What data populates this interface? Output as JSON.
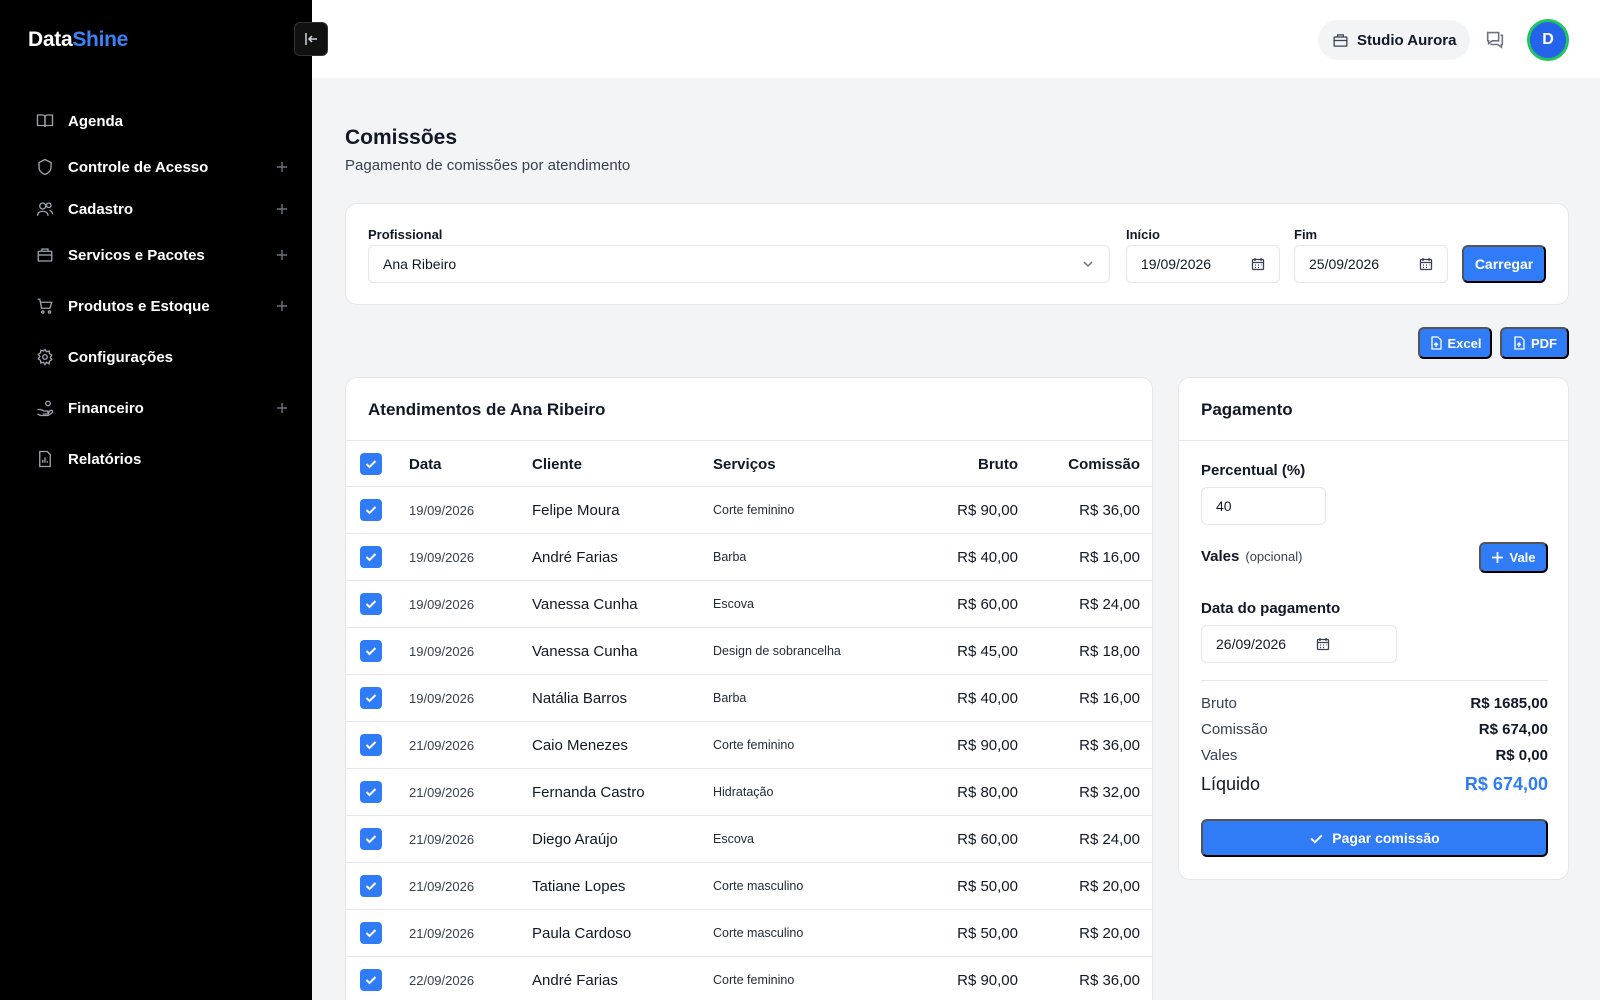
{
  "brand": {
    "part1": "Data",
    "part2": "Shine",
    "accent": "#3b82f6"
  },
  "sidebar": {
    "items": [
      {
        "label": "Agenda",
        "icon": "book-icon",
        "expandable": false
      },
      {
        "label": "Controle de Acesso",
        "icon": "shield-icon",
        "expandable": true
      },
      {
        "label": "Cadastro",
        "icon": "users-icon",
        "expandable": true
      },
      {
        "label": "Servicos e Pacotes",
        "icon": "briefcase-icon",
        "expandable": true
      },
      {
        "label": "Produtos e Estoque",
        "icon": "cart-icon",
        "expandable": true
      },
      {
        "label": "Configurações",
        "icon": "gear-icon",
        "expandable": false
      },
      {
        "label": "Financeiro",
        "icon": "hand-coins-icon",
        "expandable": true
      },
      {
        "label": "Relatórios",
        "icon": "report-icon",
        "expandable": false
      }
    ]
  },
  "topbar": {
    "studio": "Studio Aurora",
    "avatar_initial": "D"
  },
  "page": {
    "title": "Comissões",
    "subtitle": "Pagamento de comissões por atendimento"
  },
  "filters": {
    "professional_label": "Profissional",
    "professional_value": "Ana Ribeiro",
    "start_label": "Início",
    "start_value": "19/09/2026",
    "end_label": "Fim",
    "end_value": "25/09/2026",
    "load_button": "Carregar"
  },
  "export": {
    "excel": "Excel",
    "pdf": "PDF"
  },
  "table": {
    "title": "Atendimentos de Ana Ribeiro",
    "headers": {
      "date": "Data",
      "client": "Cliente",
      "services": "Serviços",
      "gross": "Bruto",
      "commission": "Comissão"
    },
    "rows": [
      {
        "date": "19/09/2026",
        "client": "Felipe Moura",
        "service": "Corte feminino",
        "gross": "R$ 90,00",
        "commission": "R$ 36,00"
      },
      {
        "date": "19/09/2026",
        "client": "André Farias",
        "service": "Barba",
        "gross": "R$ 40,00",
        "commission": "R$ 16,00"
      },
      {
        "date": "19/09/2026",
        "client": "Vanessa Cunha",
        "service": "Escova",
        "gross": "R$ 60,00",
        "commission": "R$ 24,00"
      },
      {
        "date": "19/09/2026",
        "client": "Vanessa Cunha",
        "service": "Design de sobrancelha",
        "gross": "R$ 45,00",
        "commission": "R$ 18,00"
      },
      {
        "date": "19/09/2026",
        "client": "Natália Barros",
        "service": "Barba",
        "gross": "R$ 40,00",
        "commission": "R$ 16,00"
      },
      {
        "date": "21/09/2026",
        "client": "Caio Menezes",
        "service": "Corte feminino",
        "gross": "R$ 90,00",
        "commission": "R$ 36,00"
      },
      {
        "date": "21/09/2026",
        "client": "Fernanda Castro",
        "service": "Hidratação",
        "gross": "R$ 80,00",
        "commission": "R$ 32,00"
      },
      {
        "date": "21/09/2026",
        "client": "Diego Araújo",
        "service": "Escova",
        "gross": "R$ 60,00",
        "commission": "R$ 24,00"
      },
      {
        "date": "21/09/2026",
        "client": "Tatiane Lopes",
        "service": "Corte masculino",
        "gross": "R$ 50,00",
        "commission": "R$ 20,00"
      },
      {
        "date": "21/09/2026",
        "client": "Paula Cardoso",
        "service": "Corte masculino",
        "gross": "R$ 50,00",
        "commission": "R$ 20,00"
      },
      {
        "date": "22/09/2026",
        "client": "André Farias",
        "service": "Corte feminino",
        "gross": "R$ 90,00",
        "commission": "R$ 36,00"
      }
    ]
  },
  "payment": {
    "title": "Pagamento",
    "percent_label": "Percentual (%)",
    "percent_value": "40",
    "vales_label": "Vales",
    "vales_optional": "(opcional)",
    "add_vale_button": "Vale",
    "date_label": "Data do pagamento",
    "date_value": "26/09/2026",
    "summary": {
      "gross_label": "Bruto",
      "gross_value": "R$ 1685,00",
      "commission_label": "Comissão",
      "commission_value": "R$ 674,00",
      "vales_label": "Vales",
      "vales_value": "R$ 0,00",
      "net_label": "Líquido",
      "net_value": "R$ 674,00"
    },
    "pay_button": "Pagar comissão"
  }
}
